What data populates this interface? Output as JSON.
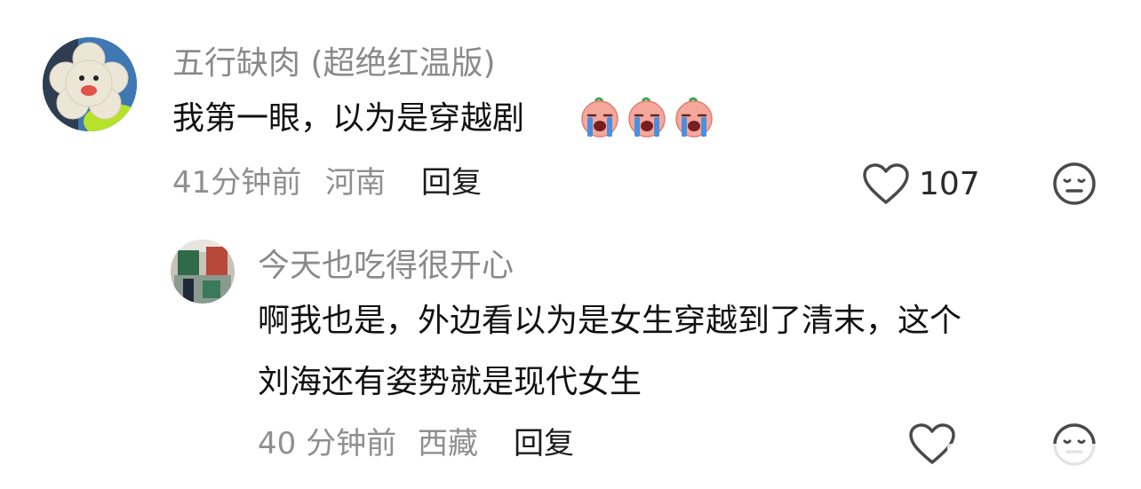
{
  "comments": [
    {
      "username": "五行缺肉 (超绝红温版)",
      "text": "我第一眼，以为是穿越剧",
      "emojis": [
        "crying-face-emoji",
        "crying-face-emoji",
        "crying-face-emoji"
      ],
      "time": "41分钟前",
      "location": "河南",
      "reply_label": "回复",
      "like_count": "107",
      "icons": {
        "like": "heart-outline-icon",
        "dislike": "meh-face-icon"
      }
    }
  ],
  "replies": [
    {
      "username": "今天也吃得很开心",
      "text_lines": [
        "啊我也是，外边看以为是女生穿越到了清末，这个",
        "刘海还有姿势就是现代女生"
      ],
      "time": "40 分钟前",
      "location": "西藏",
      "reply_label": "回复",
      "icons": {
        "like": "heart-outline-icon",
        "dislike": "meh-face-icon"
      }
    }
  ],
  "colors": {
    "username": "#8a8a8a",
    "content": "#111111",
    "meta": "#8f8f8f",
    "emoji_face": "#f6a79c",
    "emoji_tears": "#4a8fe0"
  }
}
